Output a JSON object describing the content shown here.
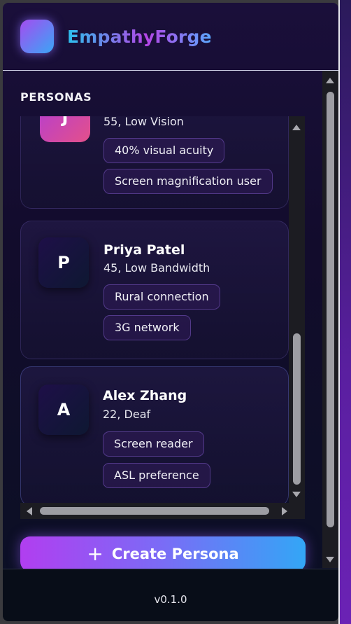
{
  "app": {
    "brand": "EmpathyForge"
  },
  "sidebar": {
    "section_label": "PERSONAS"
  },
  "personas": [
    {
      "initial": "J",
      "name": "",
      "meta": "55, Low Vision",
      "tags": [
        "40% visual acuity",
        "Screen magnification user"
      ]
    },
    {
      "initial": "P",
      "name": "Priya Patel",
      "meta": "45, Low Bandwidth",
      "tags": [
        "Rural connection",
        "3G network"
      ]
    },
    {
      "initial": "A",
      "name": "Alex Zhang",
      "meta": "22, Deaf",
      "tags": [
        "Screen reader",
        "ASL preference"
      ]
    }
  ],
  "actions": {
    "create_label": "Create Persona",
    "create_icon": "plus-icon"
  },
  "footer": {
    "version": "v0.1.0"
  },
  "colors": {
    "accent_start": "#b13ef0",
    "accent_end": "#33a6f6",
    "background": "#120c2c"
  }
}
